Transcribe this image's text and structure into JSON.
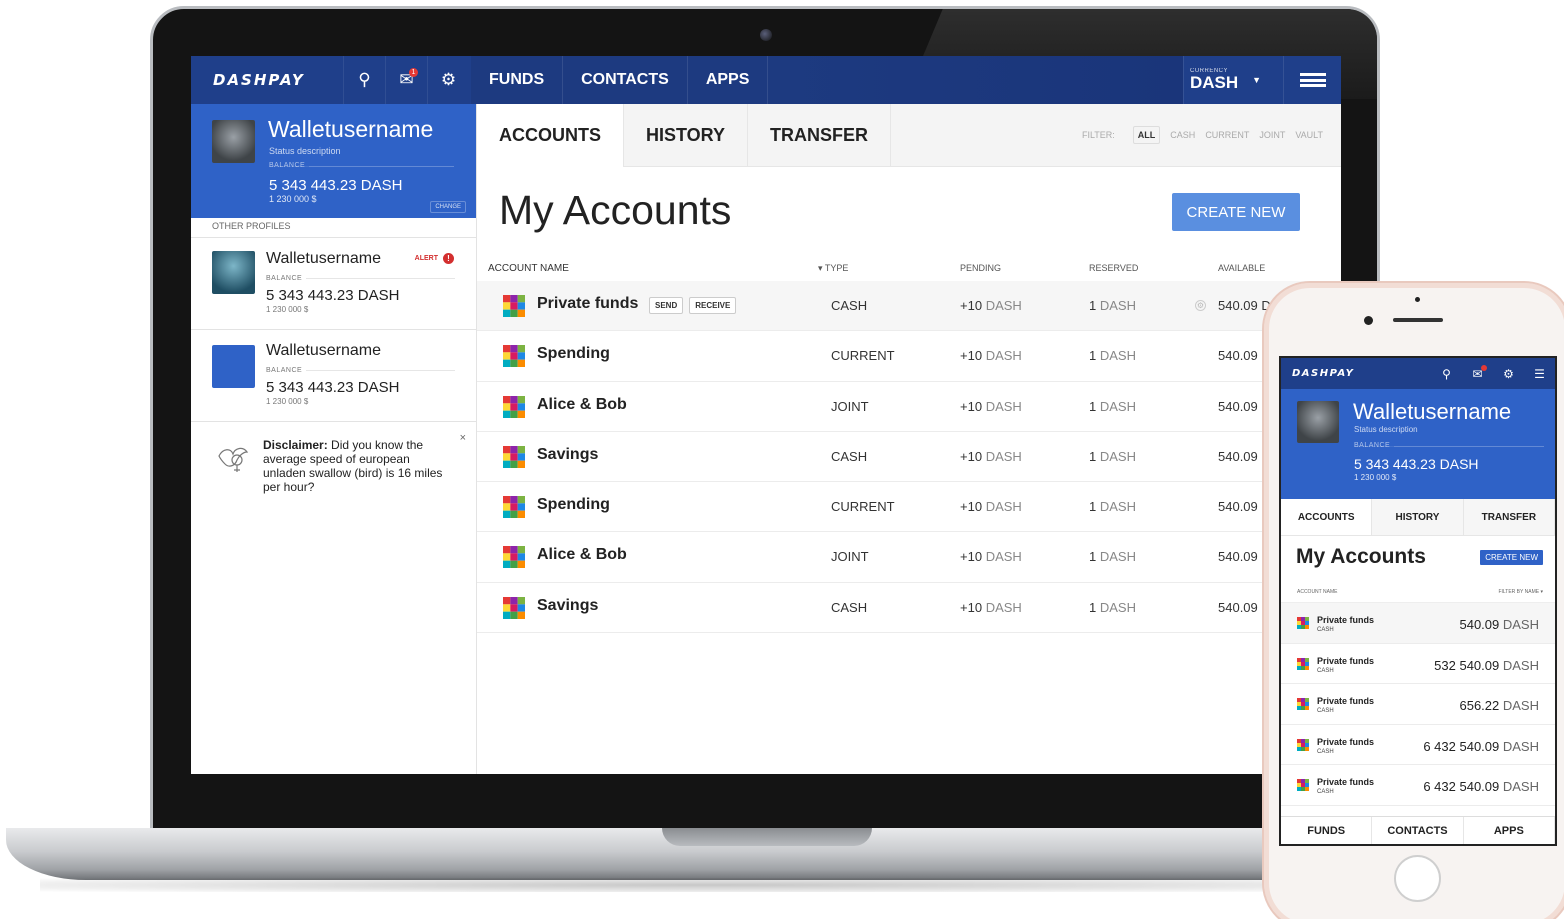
{
  "app": {
    "brand": "DASHPAY",
    "nav": [
      "FUNDS",
      "CONTACTS",
      "APPS"
    ],
    "currency_label": "CURRENCY",
    "currency_value": "DASH",
    "notification_count": "1"
  },
  "current_profile": {
    "name": "Walletusername",
    "status": "Status description",
    "balance_label": "BALANCE",
    "balance": "5 343 443.23 DASH",
    "fiat": "1 230 000 $",
    "change_label": "CHANGE"
  },
  "other_profiles": {
    "header": "OTHER PROFILES",
    "items": [
      {
        "name": "Walletusername",
        "balance_label": "BALANCE",
        "balance": "5 343 443.23 DASH",
        "fiat": "1 230 000 $",
        "alert": "ALERT"
      },
      {
        "name": "Walletusername",
        "balance_label": "BALANCE",
        "balance": "5 343 443.23 DASH",
        "fiat": "1 230 000 $"
      }
    ]
  },
  "disclaimer": {
    "bold": "Disclaimer:",
    "text": " Did you know the average speed of european unladen swallow (bird) is 16 miles per hour?",
    "close": "×"
  },
  "tabs": [
    "ACCOUNTS",
    "HISTORY",
    "TRANSFER"
  ],
  "filter": {
    "label": "FILTER:",
    "options": [
      "ALL",
      "CASH",
      "CURRENT",
      "JOINT",
      "VAULT"
    ]
  },
  "page_title": "My Accounts",
  "create_label": "CREATE NEW",
  "columns": {
    "name": "ACCOUNT NAME",
    "type": "▾ TYPE",
    "pending": "PENDING",
    "reserved": "RESERVED",
    "available": "AVAILABLE"
  },
  "row_actions": [
    "SEND",
    "RECEIVE"
  ],
  "accounts": [
    {
      "name": "Private funds",
      "type": "CASH",
      "pending_num": "+10",
      "pending_unit": "DASH",
      "reserved_num": "1",
      "reserved_unit": "DASH",
      "available": "540.09 D"
    },
    {
      "name": "Spending",
      "type": "CURRENT",
      "pending_num": "+10",
      "pending_unit": "DASH",
      "reserved_num": "1",
      "reserved_unit": "DASH",
      "available": "540.09"
    },
    {
      "name": "Alice & Bob",
      "type": "JOINT",
      "pending_num": "+10",
      "pending_unit": "DASH",
      "reserved_num": "1",
      "reserved_unit": "DASH",
      "available": "540.09"
    },
    {
      "name": "Savings",
      "type": "CASH",
      "pending_num": "+10",
      "pending_unit": "DASH",
      "reserved_num": "1",
      "reserved_unit": "DASH",
      "available": "540.09"
    },
    {
      "name": "Spending",
      "type": "CURRENT",
      "pending_num": "+10",
      "pending_unit": "DASH",
      "reserved_num": "1",
      "reserved_unit": "DASH",
      "available": "540.09"
    },
    {
      "name": "Alice & Bob",
      "type": "JOINT",
      "pending_num": "+10",
      "pending_unit": "DASH",
      "reserved_num": "1",
      "reserved_unit": "DASH",
      "available": "540.09"
    },
    {
      "name": "Savings",
      "type": "CASH",
      "pending_num": "+10",
      "pending_unit": "DASH",
      "reserved_num": "1",
      "reserved_unit": "DASH",
      "available": "540.09"
    }
  ],
  "phone": {
    "brand": "DASHPAY",
    "profile": {
      "name": "Walletusername",
      "status": "Status description",
      "balance_label": "BALANCE",
      "balance": "5 343 443.23 DASH",
      "fiat": "1 230 000 $"
    },
    "tabs": [
      "ACCOUNTS",
      "HISTORY",
      "TRANSFER"
    ],
    "title": "My Accounts",
    "create_label": "CREATE NEW",
    "list_header": "ACCOUNT NAME",
    "filter_by": "FILTER BY NAME ▾",
    "accounts": [
      {
        "name": "Private funds",
        "type": "CASH",
        "value": "540.09",
        "unit": "DASH"
      },
      {
        "name": "Private funds",
        "type": "CASH",
        "value": "532 540.09",
        "unit": "DASH"
      },
      {
        "name": "Private funds",
        "type": "CASH",
        "value": "656.22",
        "unit": "DASH"
      },
      {
        "name": "Private funds",
        "type": "CASH",
        "value": "6 432 540.09",
        "unit": "DASH"
      },
      {
        "name": "Private funds",
        "type": "CASH",
        "value": "6 432 540.09",
        "unit": "DASH"
      }
    ],
    "bottom_nav": [
      "FUNDS",
      "CONTACTS",
      "APPS"
    ]
  },
  "icons": {
    "search": "search-icon",
    "messages": "mail-icon",
    "settings": "gear-icon",
    "menu": "hamburger-menu-icon",
    "account": "account-mosaic-icon",
    "disclaimer": "bird-sketch-icon"
  },
  "colors": {
    "brand_navy": "#1f3f8a",
    "profile_blue": "#2f62c7",
    "button_blue": "#5a8fe0",
    "alert_red": "#d32f2f"
  }
}
